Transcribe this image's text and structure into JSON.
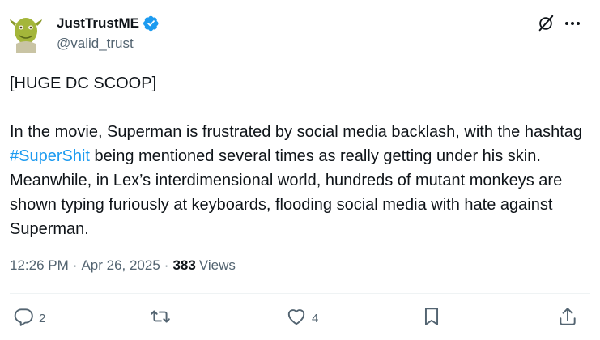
{
  "author": {
    "display_name": "JustTrustME",
    "handle": "@valid_trust",
    "verified": true
  },
  "post": {
    "lines": [
      "[HUGE DC SCOOP]"
    ],
    "text_before_hashtag": "In the movie, Superman is frustrated by social media backlash, with the hashtag ",
    "hashtag": "#SuperShit",
    "text_after_hashtag": " being mentioned several times as really getting under his skin. Meanwhile, in Lex’s interdimensional world, hundreds of mutant monkeys are shown typing furiously at keyboards, flooding social media with hate against Superman."
  },
  "meta": {
    "time": "12:26 PM",
    "separator": "·",
    "date": "Apr 26, 2025",
    "views_count": "383",
    "views_label": "Views"
  },
  "actions": {
    "reply_count": "2",
    "retweet_count": "",
    "like_count": "4"
  },
  "colors": {
    "accent": "#1d9bf0",
    "text_primary": "#0f1419",
    "text_secondary": "#536471"
  },
  "icons": {
    "verified": "verified-badge-icon",
    "grok": "grok-icon",
    "more": "more-dots-icon",
    "reply": "reply-icon",
    "retweet": "retweet-icon",
    "like": "heart-icon",
    "bookmark": "bookmark-icon",
    "share": "share-icon"
  }
}
